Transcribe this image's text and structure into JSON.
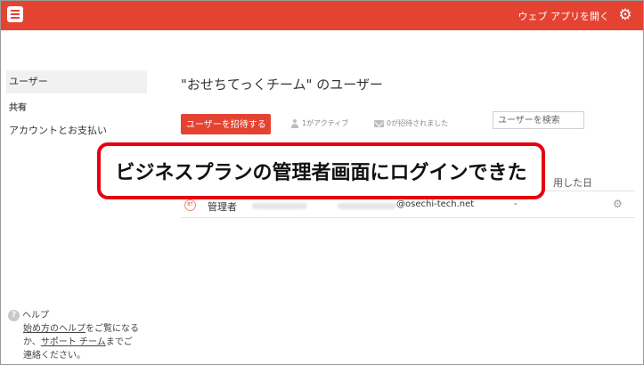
{
  "topbar": {
    "open_web_app": "ウェブ アプリを開く",
    "logo_icon": "todoist-logo-icon",
    "settings_icon": "gear-icon"
  },
  "sidebar": {
    "users": "ユーザー",
    "shared_heading": "共有",
    "billing": "アカウントとお支払い"
  },
  "help": {
    "title": "ヘルプ",
    "line1_link": "始め方のヘルプ",
    "line1_rest": "をご覧になる",
    "line2_prefix": "か、",
    "line2_link": "サポート チーム",
    "line2_rest": "までご",
    "line3": "連絡ください。"
  },
  "main": {
    "title": "\"おせちてっくチーム\" のユーザー",
    "invite_button": "ユーザーを招待する",
    "active_count": "1がアクティブ",
    "invited_count": "0が招待されました",
    "search_placeholder": "ユーザーを検索",
    "col_last_used": "用した日"
  },
  "users": [
    {
      "avatar": "BT",
      "name": "管理者",
      "email_suffix": "@osechi-tech.net",
      "last_used": "-"
    }
  ],
  "annotation": {
    "text": "ビジネスプランの管理者画面にログインできた",
    "border_color": "#e60012"
  },
  "colors": {
    "brand": "#e44332"
  }
}
